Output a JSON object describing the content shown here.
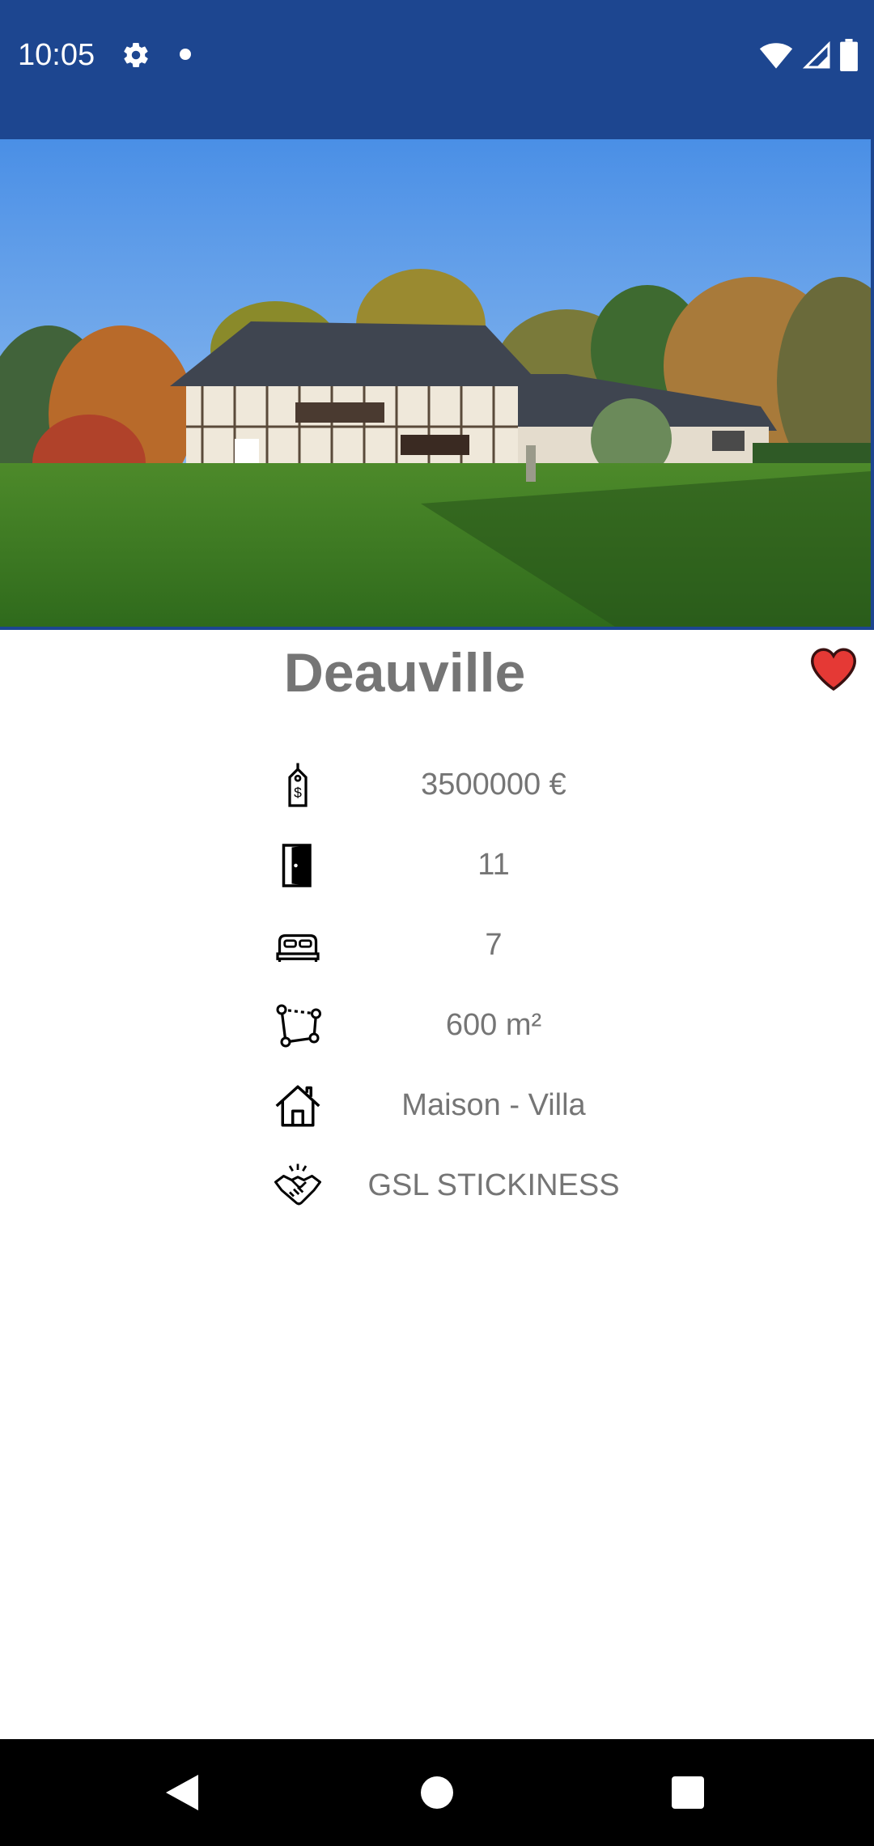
{
  "status_bar": {
    "time": "10:05",
    "icons": [
      "settings-gear-icon",
      "notification-dot-icon",
      "wifi-icon",
      "cellular-signal-icon",
      "battery-icon"
    ],
    "background_color": "#1d4690"
  },
  "property": {
    "title": "Deauville",
    "is_favorite": true,
    "favorite_color": "#e53935",
    "details": [
      {
        "icon": "price-tag-icon",
        "value": "3500000 €"
      },
      {
        "icon": "door-icon",
        "value": "11"
      },
      {
        "icon": "bed-icon",
        "value": "7"
      },
      {
        "icon": "area-polygon-icon",
        "value": "600 m²"
      },
      {
        "icon": "house-icon",
        "value": "Maison - Villa"
      },
      {
        "icon": "handshake-icon",
        "value": "GSL STICKINESS"
      }
    ]
  },
  "nav_bar": {
    "buttons": [
      "back-icon",
      "home-icon",
      "recents-icon"
    ]
  }
}
